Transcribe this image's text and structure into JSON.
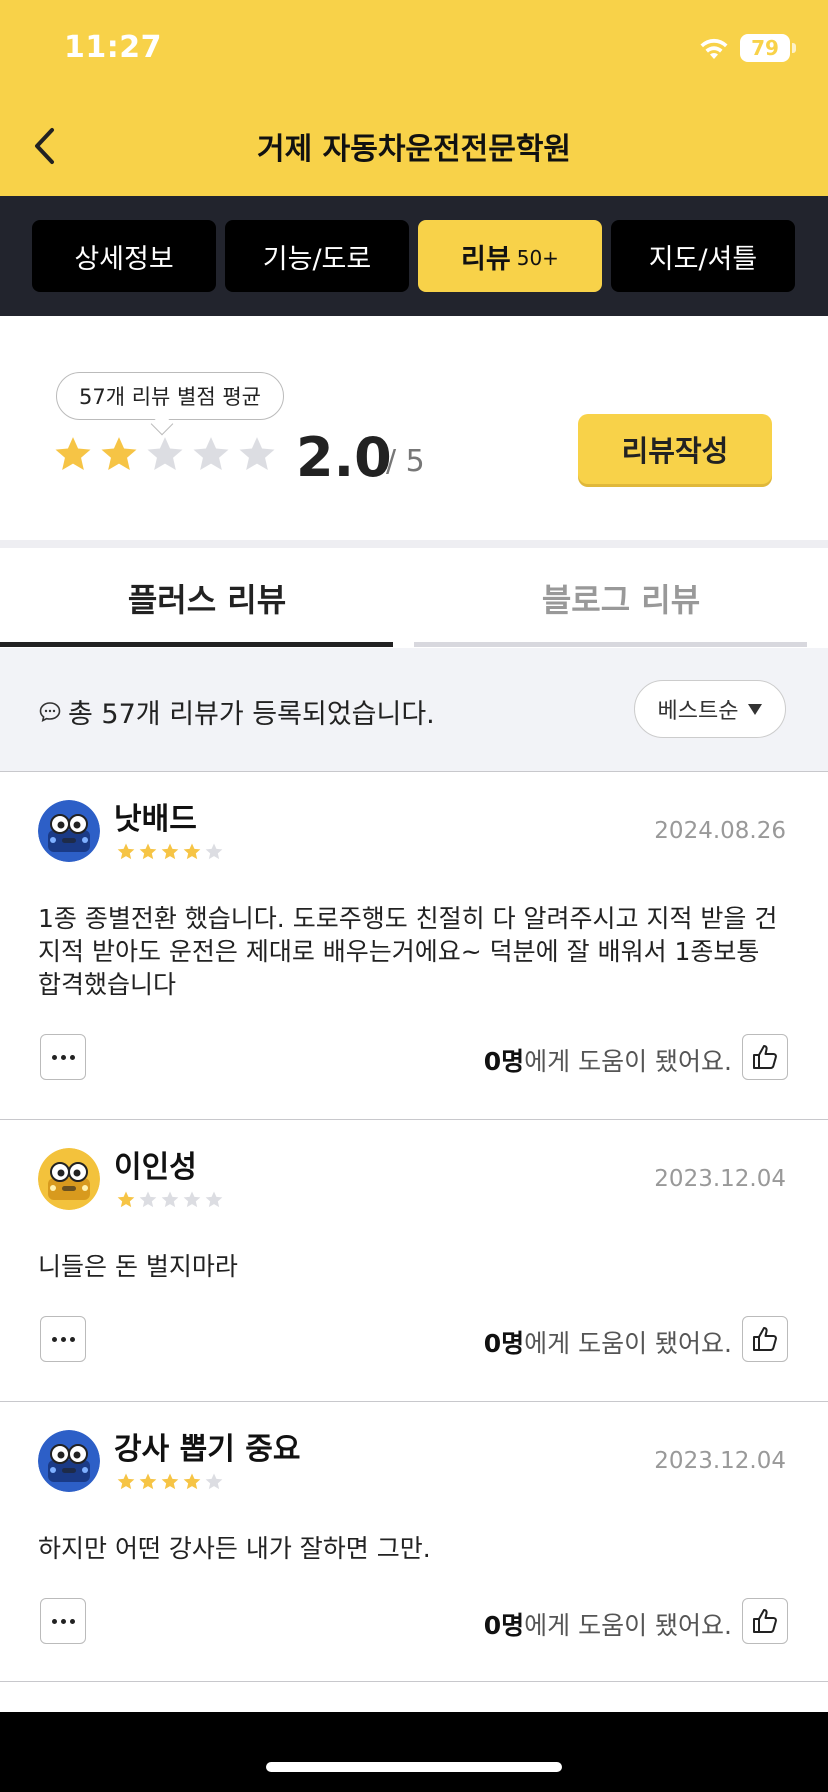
{
  "status_bar": {
    "time": "11:27",
    "battery": "79"
  },
  "header": {
    "title": "거제 자동차운전전문학원",
    "back_icon": "chevron-left-icon"
  },
  "tabs": [
    {
      "label": "상세정보",
      "badge": ""
    },
    {
      "label": "기능/도로",
      "badge": ""
    },
    {
      "label": "리뷰",
      "badge": "50+"
    },
    {
      "label": "지도/셔틀",
      "badge": ""
    }
  ],
  "active_tab": 2,
  "rating": {
    "bubble": "57개 리뷰 별점 평균",
    "average": "2.0",
    "max": "/ 5",
    "stars_filled": 2,
    "stars_total": 5,
    "write_button": "리뷰작성"
  },
  "review_tabs": {
    "plus": "플러스 리뷰",
    "blog": "블로그 리뷰"
  },
  "summary": {
    "text": "총 57개 리뷰가 등록되었습니다.",
    "sort": "베스트순"
  },
  "reviews": [
    {
      "name": "낫배드",
      "stars": 4,
      "date": "2024.08.26",
      "body": "1종 종별전환 했습니다. 도로주행도 친절히 다 알려주시고 지적 받을 건 지적 받아도 운전은 제대로 배우는거에요~ 덕분에 잘 배워서 1종보통 합격했습니다",
      "helpful_count": "0명",
      "helpful_text": "에게 도움이 됐어요.",
      "avatar": "blue-car-avatar"
    },
    {
      "name": "이인성",
      "stars": 1,
      "date": "2023.12.04",
      "body": "니들은 돈 벌지마라",
      "helpful_count": "0명",
      "helpful_text": "에게 도움이 됐어요.",
      "avatar": "yellow-car-avatar"
    },
    {
      "name": "강사 뽑기 중요",
      "stars": 4,
      "date": "2023.12.04",
      "body": "하지만 어떤 강사든 내가 잘하면 그만.",
      "helpful_count": "0명",
      "helpful_text": "에게 도움이 됐어요.",
      "avatar": "blue-car-avatar"
    }
  ],
  "colors": {
    "brand_yellow": "#f8d249",
    "tabbar_bg": "#22242d",
    "star_filled": "#f6c445",
    "star_empty": "#dcdde2"
  }
}
